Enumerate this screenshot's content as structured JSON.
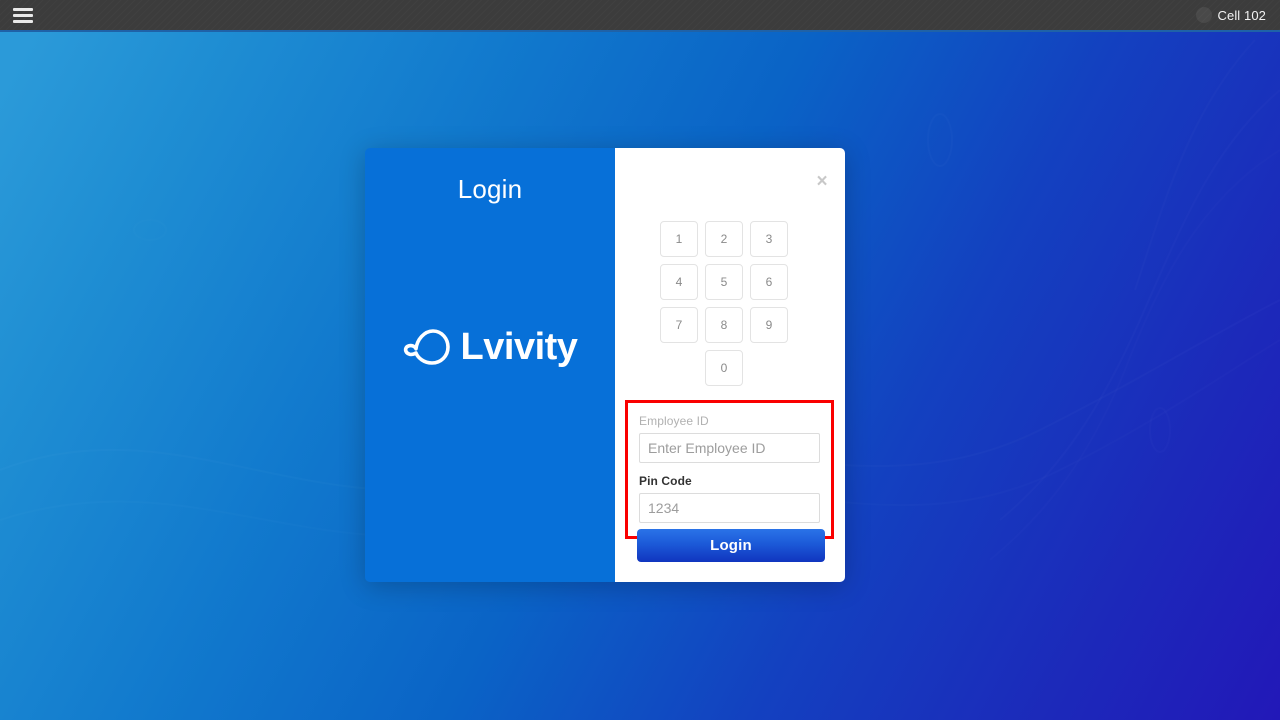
{
  "topbar": {
    "menu_icon": "hamburger-menu-icon",
    "avatar_icon": "user-avatar-icon",
    "cell_label": "Cell 102"
  },
  "modal": {
    "title": "Login",
    "close_label": "×",
    "brand": {
      "logo_icon": "lvivity-loop-logo-icon",
      "name": "Lvivity"
    },
    "keypad": {
      "keys": [
        "1",
        "2",
        "3",
        "4",
        "5",
        "6",
        "7",
        "8",
        "9",
        "0"
      ]
    },
    "form": {
      "employee_id": {
        "label": "Employee ID",
        "placeholder": "Enter Employee ID",
        "value": ""
      },
      "pin_code": {
        "label": "Pin Code",
        "placeholder": "1234",
        "value": ""
      }
    },
    "submit_label": "Login"
  },
  "colors": {
    "topbar_bg": "#3c3c3c",
    "topbar_accent": "#1f62a8",
    "panel_blue": "#0770d8",
    "button_blue": "#1c5ad8",
    "highlight_red": "#fa0000",
    "bg_gradient_start": "#2b9ad9",
    "bg_gradient_end": "#2218b8"
  }
}
